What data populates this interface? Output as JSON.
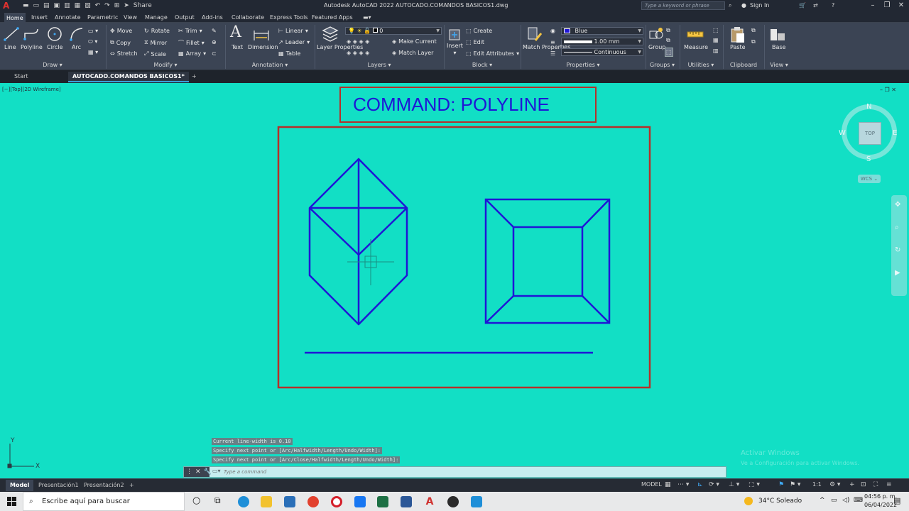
{
  "window": {
    "app_logo": "A",
    "title": "Autodesk AutoCAD 2022    AUTOCADO.COMANDOS BASICOS1.dwg",
    "share_label": "Share",
    "search_placeholder": "Type a keyword or phrase",
    "sign_in": "Sign In"
  },
  "ribbon_tabs": [
    "Home",
    "Insert",
    "Annotate",
    "Parametric",
    "View",
    "Manage",
    "Output",
    "Add-ins",
    "Collaborate",
    "Express Tools",
    "Featured Apps"
  ],
  "ribbon": {
    "draw": {
      "title": "Draw ▾",
      "line": "Line",
      "polyline": "Polyline",
      "circle": "Circle",
      "arc": "Arc"
    },
    "modify": {
      "title": "Modify ▾",
      "move": "Move",
      "rotate": "Rotate",
      "trim": "Trim",
      "copy": "Copy",
      "mirror": "Mirror",
      "fillet": "Fillet",
      "stretch": "Stretch",
      "scale": "Scale",
      "array": "Array"
    },
    "annotation": {
      "title": "Annotation ▾",
      "text": "Text",
      "dimension": "Dimension",
      "linear": "Linear",
      "leader": "Leader",
      "table": "Table"
    },
    "layers": {
      "title": "Layers ▾",
      "layer_properties": "Layer Properties",
      "current_layer": "0",
      "make_current": "Make Current",
      "match_layer": "Match Layer"
    },
    "block": {
      "title": "Block ▾",
      "insert": "Insert",
      "create": "Create",
      "edit": "Edit",
      "edit_attributes": "Edit Attributes"
    },
    "properties": {
      "title": "Properties ▾",
      "match_properties": "Match Properties",
      "color": "Blue",
      "lineweight": "1.00 mm",
      "linetype": "Continuous"
    },
    "groups": {
      "title": "Groups ▾",
      "group": "Group"
    },
    "utilities": {
      "title": "Utilities ▾",
      "measure": "Measure"
    },
    "clipboard": {
      "title": "Clipboard",
      "paste": "Paste"
    },
    "view": {
      "title": "View ▾",
      "base": "Base"
    }
  },
  "file_tabs": {
    "start": "Start",
    "active": "AUTOCADO.COMANDOS BASICOS1*",
    "add": "+"
  },
  "drawing": {
    "viewport_label": "[−][Top][2D Wireframe]",
    "heading": "COMMAND: POLYLINE",
    "colors": {
      "background": "#12dfc5",
      "frame": "#b5302a",
      "geometry": "#1f16d6"
    }
  },
  "navigation": {
    "north": "N",
    "south": "S",
    "east": "E",
    "west": "W",
    "cube_face": "TOP",
    "wcs": "WCS ⌄"
  },
  "command": {
    "history": [
      "Current line-width is 0.10",
      "Specify next point or [Arc/Halfwidth/Length/Undo/Width]:",
      "Specify next point or [Arc/Close/Halfwidth/Length/Undo/Width]:"
    ],
    "placeholder": "Type a command"
  },
  "watermark": {
    "line1": "Activar Windows",
    "line2": "Ve a Configuración para activar Windows."
  },
  "layout_tabs": [
    "Model",
    "Presentación1",
    "Presentación2",
    "+"
  ],
  "status": {
    "space": "MODEL",
    "scale": "1:1"
  },
  "taskbar": {
    "search": "Escribe aquí para buscar",
    "weather": "34°C  Soleado",
    "time": "04:56 p. m.",
    "date": "06/04/2022"
  }
}
